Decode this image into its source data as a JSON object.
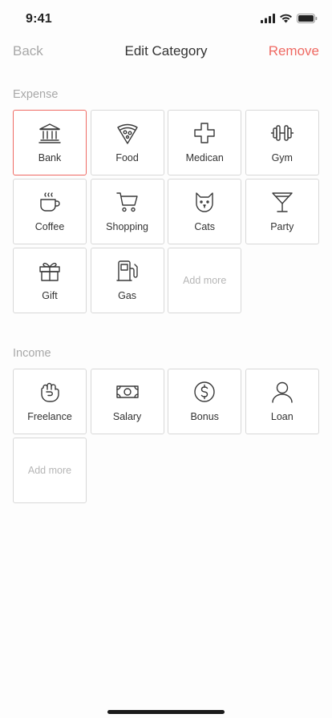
{
  "status_bar": {
    "time": "9:41",
    "icons": [
      "signal-icon",
      "wifi-icon",
      "battery-icon"
    ]
  },
  "nav": {
    "back_label": "Back",
    "title": "Edit Category",
    "remove_label": "Remove"
  },
  "colors": {
    "accent": "#ef6a63",
    "muted": "#a8a8a8",
    "text": "#333333",
    "border": "#d8d8d8"
  },
  "expense": {
    "section_label": "Expense",
    "items": [
      {
        "label": "Bank",
        "icon": "bank-icon",
        "selected": true
      },
      {
        "label": "Food",
        "icon": "pizza-icon"
      },
      {
        "label": "Medican",
        "icon": "medical-cross-icon"
      },
      {
        "label": "Gym",
        "icon": "dumbbell-icon"
      },
      {
        "label": "Coffee",
        "icon": "coffee-cup-icon"
      },
      {
        "label": "Shopping",
        "icon": "shopping-cart-icon"
      },
      {
        "label": "Cats",
        "icon": "cat-icon"
      },
      {
        "label": "Party",
        "icon": "cocktail-icon"
      },
      {
        "label": "Gift",
        "icon": "gift-icon"
      },
      {
        "label": "Gas",
        "icon": "gas-pump-icon"
      }
    ],
    "add_more_label": "Add more"
  },
  "income": {
    "section_label": "Income",
    "items": [
      {
        "label": "Freelance",
        "icon": "fist-icon"
      },
      {
        "label": "Salary",
        "icon": "banknote-icon"
      },
      {
        "label": "Bonus",
        "icon": "dollar-coin-icon"
      },
      {
        "label": "Loan",
        "icon": "person-icon"
      }
    ],
    "add_more_label": "Add more"
  }
}
